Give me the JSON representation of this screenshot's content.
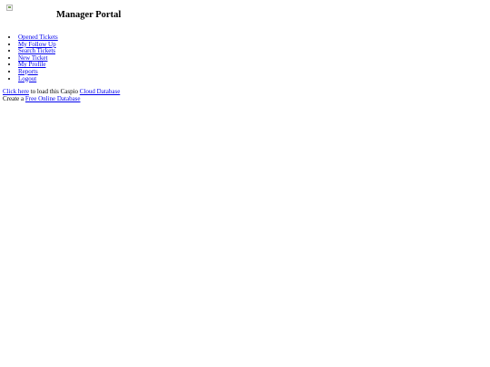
{
  "header": {
    "logo_icon": "broken-image-icon",
    "title": "Manager Portal"
  },
  "nav": {
    "items": [
      {
        "label": "Opened Tickets"
      },
      {
        "label": "My Follow Up"
      },
      {
        "label": "Search Tickets"
      },
      {
        "label": "New Ticket"
      },
      {
        "label": "My Profile"
      },
      {
        "label": "Reports"
      },
      {
        "label": "Logout"
      }
    ]
  },
  "footer": {
    "line1": {
      "link1": "Click here",
      "text": " to load this Caspio ",
      "link2": "Cloud Database"
    },
    "line2": {
      "text": "Create a ",
      "link": "Free Online Database"
    }
  },
  "colors": {
    "link": "#0000ee",
    "text": "#000000",
    "background": "#ffffff"
  }
}
